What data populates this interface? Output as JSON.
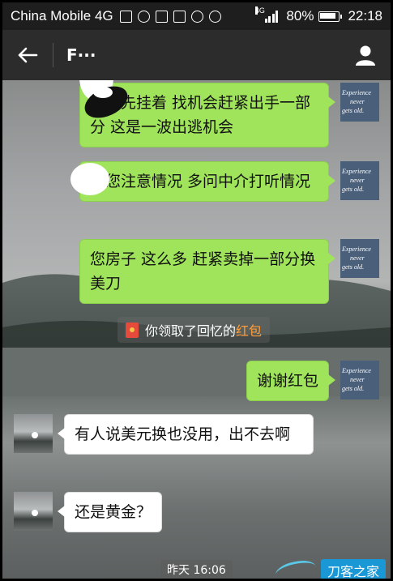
{
  "status_bar": {
    "carrier": "China Mobile 4G",
    "network_tag": "4G",
    "battery": "80%",
    "time": "22:18",
    "icons": [
      "sim-icon",
      "weibo-icon",
      "gallery-icon",
      "keyboard-icon",
      "lock-icon",
      "do-not-disturb-icon"
    ]
  },
  "title_bar": {
    "title": "F···"
  },
  "messages": [
    {
      "side": "right",
      "text": "    的您先挂着  找机会赶紧出手一部分 这是一波出逃机会"
    },
    {
      "side": "right",
      "text": "    的您注意情况  多问中介打听情况"
    },
    {
      "side": "right",
      "text": "您房子 这么多 赶紧卖掉一部分换美刀"
    },
    {
      "side": "right",
      "text": "谢谢红包"
    },
    {
      "side": "left",
      "text": "有人说美元换也没用，出不去啊"
    },
    {
      "side": "left",
      "text": "还是黄金？"
    }
  ],
  "system_notice": {
    "prefix": "你领取了回忆的",
    "link": "红包"
  },
  "time_label": "昨天 16:06",
  "avatar_me_lines": [
    "Experience",
    "never",
    "gets old."
  ],
  "watermark": "刀客之家",
  "colors": {
    "status_bar": "#1e1e1e",
    "title_bar": "#2c2c2c",
    "bubble_sent": "#9fe45b",
    "bubble_received": "#ffffff",
    "red_packet_link": "#ff9c3a"
  }
}
